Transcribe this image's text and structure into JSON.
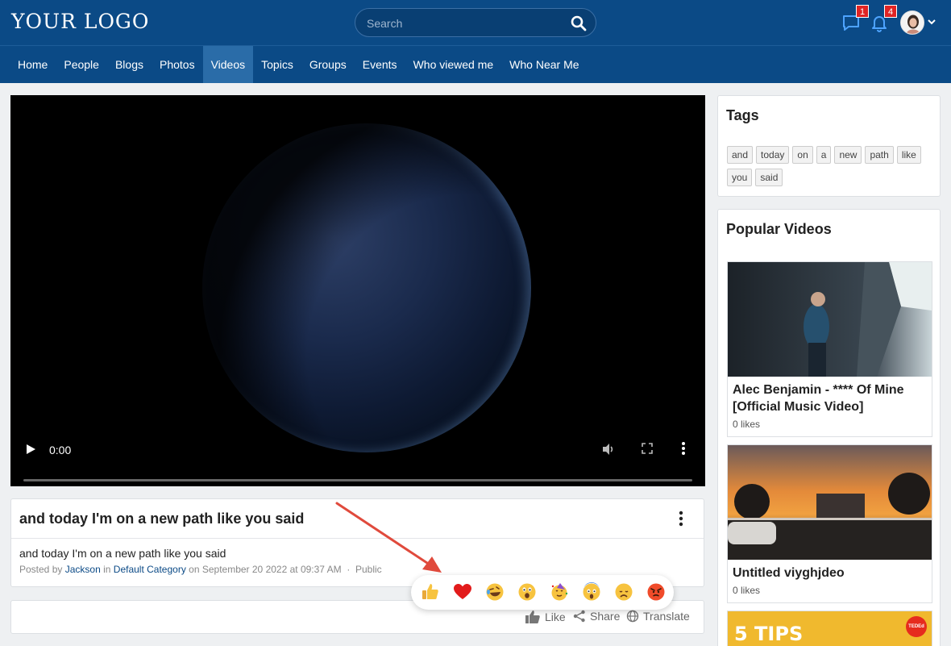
{
  "header": {
    "logo": "YOUR LOGO",
    "search_placeholder": "Search",
    "messages_count": "1",
    "notifications_count": "4"
  },
  "nav": {
    "items": [
      "Home",
      "People",
      "Blogs",
      "Photos",
      "Videos",
      "Topics",
      "Groups",
      "Events",
      "Who viewed me",
      "Who Near Me"
    ],
    "active": "Videos"
  },
  "video_player": {
    "time": "0:00"
  },
  "post": {
    "title": "and today I'm on a new path like you said",
    "description": "and today I'm on a new path like you said",
    "posted_by_prefix": "Posted by",
    "author": "Jackson",
    "in_word": "in",
    "category": "Default Category",
    "date": "on September 20 2022 at 09:37 AM",
    "separator": "·",
    "privacy": "Public"
  },
  "actions": {
    "like": "Like",
    "share": "Share",
    "translate": "Translate"
  },
  "reactions": [
    "thumbs-up-emoji",
    "heart-emoji",
    "rofl-emoji",
    "surprised-emoji",
    "party-emoji",
    "scream-emoji",
    "sad-emoji",
    "angry-emoji"
  ],
  "tags_section": {
    "title": "Tags",
    "tags": [
      "and",
      "today",
      "on",
      "a",
      "new",
      "path",
      "like",
      "you",
      "said"
    ]
  },
  "popular_videos": {
    "title": "Popular Videos",
    "items": [
      {
        "title": "Alec Benjamin - **** Of Mine [Official Music Video]",
        "likes": "0 likes"
      },
      {
        "title": "Untitled viyghjdeo",
        "likes": "0 likes"
      },
      {
        "title": "",
        "likes": "",
        "thumb_text": "5 TIPS",
        "thumb_badge": "TEDEd"
      }
    ]
  },
  "colors": {
    "header_bg": "#0b4a86",
    "nav_active_bg": "#2a6ca8",
    "badge": "#e02424",
    "link": "#0b4a86",
    "arrow": "#e04a3c"
  }
}
